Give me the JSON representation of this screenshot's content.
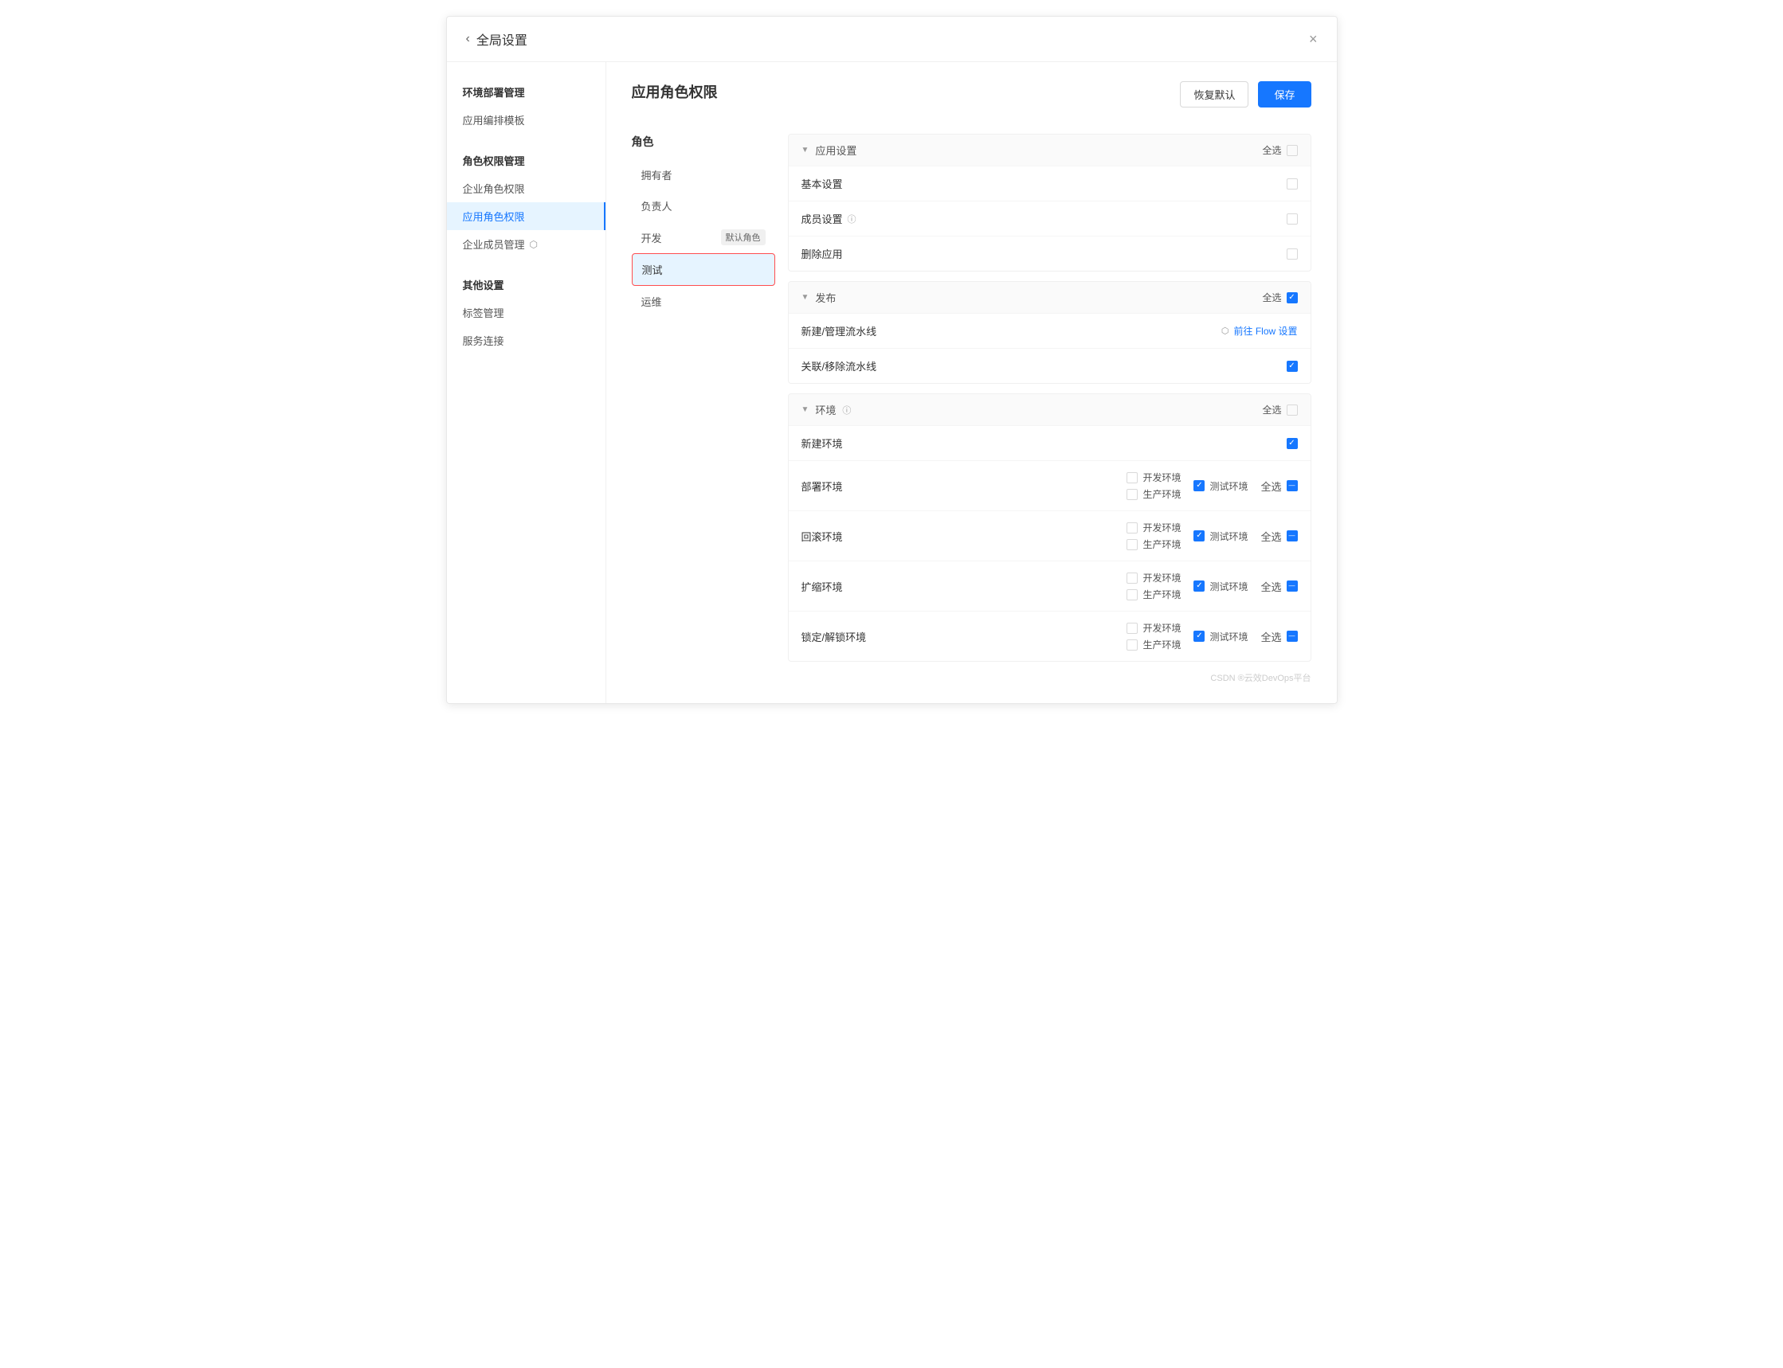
{
  "header": {
    "back_label": "全局设置",
    "close_icon": "×"
  },
  "sidebar": {
    "sections": [
      {
        "title": "环境部署管理",
        "items": [
          {
            "id": "app-template",
            "label": "应用编排模板",
            "active": false
          }
        ]
      },
      {
        "title": "角色权限管理",
        "items": [
          {
            "id": "enterprise-role",
            "label": "企业角色权限",
            "active": false
          },
          {
            "id": "app-role",
            "label": "应用角色权限",
            "active": true
          },
          {
            "id": "member-mgmt",
            "label": "企业成员管理",
            "active": false,
            "external": true
          }
        ]
      },
      {
        "title": "其他设置",
        "items": [
          {
            "id": "tag-mgmt",
            "label": "标签管理",
            "active": false
          },
          {
            "id": "service-connect",
            "label": "服务连接",
            "active": false
          }
        ]
      }
    ]
  },
  "page": {
    "title": "应用角色权限"
  },
  "roles": {
    "label": "角色",
    "items": [
      {
        "id": "owner",
        "label": "拥有者",
        "active": false,
        "badge": ""
      },
      {
        "id": "responsible",
        "label": "负责人",
        "active": false,
        "badge": ""
      },
      {
        "id": "dev",
        "label": "开发",
        "active": false,
        "badge": "默认角色"
      },
      {
        "id": "test",
        "label": "测试",
        "active": true,
        "badge": "",
        "bordered": true
      },
      {
        "id": "ops",
        "label": "运维",
        "active": false,
        "badge": ""
      }
    ]
  },
  "toolbar": {
    "restore_label": "恢复默认",
    "save_label": "保存"
  },
  "permission_groups": [
    {
      "id": "app-settings",
      "title": "应用设置",
      "collapsed": false,
      "select_all_label": "全选",
      "select_all_checked": false,
      "items": [
        {
          "id": "basic-settings",
          "label": "基本设置",
          "checked": false,
          "type": "simple"
        },
        {
          "id": "member-settings",
          "label": "成员设置",
          "checked": false,
          "type": "simple",
          "info": true
        },
        {
          "id": "delete-app",
          "label": "删除应用",
          "checked": false,
          "type": "simple"
        }
      ]
    },
    {
      "id": "publish",
      "title": "发布",
      "collapsed": false,
      "select_all_label": "全选",
      "select_all_checked": true,
      "items": [
        {
          "id": "manage-pipeline",
          "label": "新建/管理流水线",
          "type": "link",
          "link_text": "前往 Flow 设置",
          "link_icon": "↗"
        },
        {
          "id": "remove-pipeline",
          "label": "关联/移除流水线",
          "checked": true,
          "type": "simple"
        }
      ]
    },
    {
      "id": "env",
      "title": "环境",
      "collapsed": false,
      "info": true,
      "select_all_label": "全选",
      "select_all_checked": false,
      "items": [
        {
          "id": "create-env",
          "label": "新建环境",
          "checked": true,
          "type": "simple"
        },
        {
          "id": "deploy-env",
          "label": "部署环境",
          "type": "multi-env",
          "envs": [
            {
              "label": "开发环境",
              "checked": false
            },
            {
              "label": "测试环境",
              "checked": true
            },
            {
              "label": "生产环境",
              "checked": false
            }
          ],
          "select_all": "全选",
          "select_all_state": "indeterminate"
        },
        {
          "id": "rollback-env",
          "label": "回滚环境",
          "type": "multi-env",
          "envs": [
            {
              "label": "开发环境",
              "checked": false
            },
            {
              "label": "测试环境",
              "checked": true
            },
            {
              "label": "生产环境",
              "checked": false
            }
          ],
          "select_all": "全选",
          "select_all_state": "indeterminate"
        },
        {
          "id": "scale-env",
          "label": "扩缩环境",
          "type": "multi-env",
          "envs": [
            {
              "label": "开发环境",
              "checked": false
            },
            {
              "label": "测试环境",
              "checked": true
            },
            {
              "label": "生产环境",
              "checked": false
            }
          ],
          "select_all": "全选",
          "select_all_state": "indeterminate"
        },
        {
          "id": "lock-env",
          "label": "锁定/解锁环境",
          "type": "multi-env",
          "envs": [
            {
              "label": "开发环境",
              "checked": false
            },
            {
              "label": "测试环境",
              "checked": true
            },
            {
              "label": "生产环境",
              "checked": false
            }
          ],
          "select_all": "全选",
          "select_all_state": "indeterminate"
        }
      ]
    }
  ],
  "footer": {
    "watermark": "CSDN ®云效DevOps平台"
  }
}
